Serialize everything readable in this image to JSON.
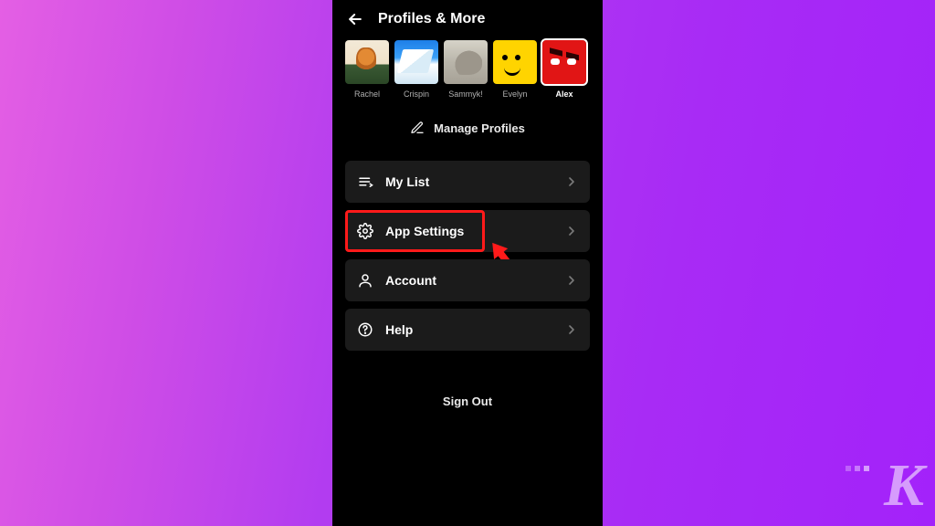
{
  "header": {
    "title": "Profiles & More"
  },
  "profiles": [
    {
      "name": "Rachel",
      "avatar": "fox",
      "selected": false
    },
    {
      "name": "Crispin",
      "avatar": "ice",
      "selected": false
    },
    {
      "name": "Sammyk!",
      "avatar": "rhino",
      "selected": false
    },
    {
      "name": "Evelyn",
      "avatar": "smile",
      "selected": false
    },
    {
      "name": "Alex",
      "avatar": "red",
      "selected": true
    }
  ],
  "manage_profiles_label": "Manage Profiles",
  "menu": {
    "my_list": {
      "label": "My List",
      "icon": "list-icon"
    },
    "app_settings": {
      "label": "App Settings",
      "icon": "gear-icon",
      "highlighted": true
    },
    "account": {
      "label": "Account",
      "icon": "person-icon"
    },
    "help": {
      "label": "Help",
      "icon": "help-icon"
    }
  },
  "sign_out_label": "Sign Out",
  "annotation": {
    "highlight_color": "#ff1a1a",
    "arrow_target": "app_settings"
  },
  "watermark": "K"
}
